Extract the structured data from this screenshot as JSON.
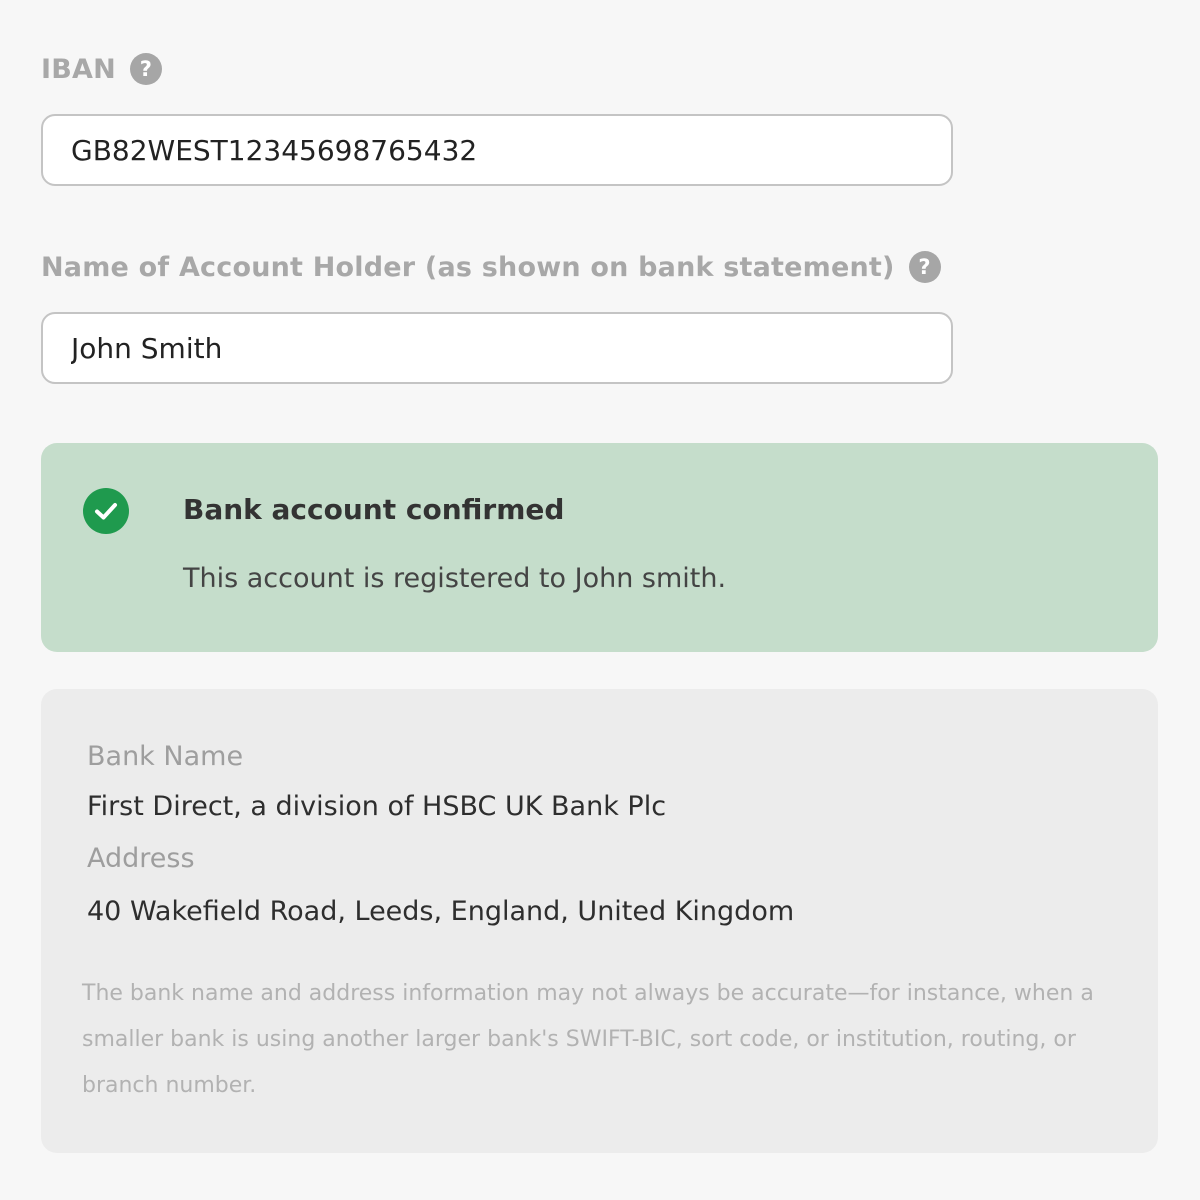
{
  "iban": {
    "label": "IBAN",
    "help_icon": "?",
    "value": "GB82WEST12345698765432"
  },
  "account_holder": {
    "label": "Name of Account Holder (as shown on bank statement)",
    "help_icon": "?",
    "value": "John Smith"
  },
  "confirmation": {
    "icon": "check-circle-icon",
    "title": "Bank account confirmed",
    "message": "This account is registered to John smith.",
    "background_color": "#c5ddcb",
    "icon_color": "#1f9a4e"
  },
  "bank_info": {
    "bank_name_label": "Bank Name",
    "bank_name_value": "First Direct, a division of HSBC UK Bank Plc",
    "address_label": "Address",
    "address_value": "40 Wakefield Road, Leeds, England, United Kingdom",
    "disclaimer": "The bank name and address information may not always be accurate—for instance, when a smaller bank is using another larger bank's SWIFT-BIC, sort code, or institution, routing, or branch number."
  }
}
